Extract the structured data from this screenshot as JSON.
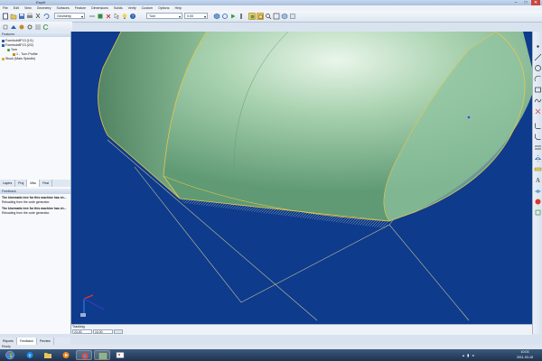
{
  "window": {
    "title": "Esprit",
    "min_label": "–",
    "max_label": "□",
    "close_label": "✕"
  },
  "menu": [
    "File",
    "Edit",
    "View",
    "Geometry",
    "Surfaces",
    "Feature",
    "Dimensions",
    "Solids",
    "Verify",
    "Custom",
    "Options",
    "Help"
  ],
  "toolbar": {
    "layer_combo": "Geometry",
    "op_combo": "Turn",
    "value_combo": "0.00"
  },
  "project": {
    "header": "Features",
    "items": [
      {
        "label": "Formhub8F13 (1/1)",
        "level": 0
      },
      {
        "label": "Formhub8F13 (2/2)",
        "level": 0
      },
      {
        "label": "Turn",
        "level": 1
      },
      {
        "label": "1 - Turn Profile",
        "level": 2
      },
      {
        "label": "Stock (Main Spindle)",
        "level": 0
      }
    ]
  },
  "nav_tabs": [
    "Layers",
    "Proj",
    "Misc",
    "Feat"
  ],
  "feedback": {
    "header": "Feedback",
    "messages": [
      {
        "title": "The kinematic tree for this machine has ch...",
        "body": "Reloading from the code generator."
      },
      {
        "title": "The kinematic tree for this machine has ch...",
        "body": "Reloading from the code generator."
      }
    ]
  },
  "bottom_tabs": [
    "Reports",
    "Feedback",
    "Preview"
  ],
  "tracking": {
    "header": "Tracking",
    "x_value": "23.00",
    "y_value": "10.00"
  },
  "viewport_tab": "Graphics 1 (1)",
  "status": "Ready",
  "clock": {
    "time": "10:03",
    "date": "2011-03-18"
  },
  "colors": {
    "viewport_bg": "#0e3b8c",
    "surface": "#7fb892",
    "edge": "#e7c74b"
  }
}
